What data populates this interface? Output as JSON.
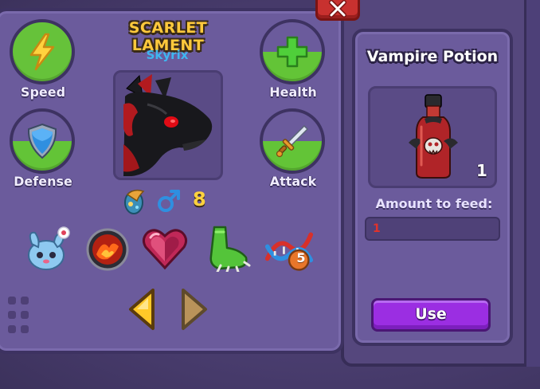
{
  "pet": {
    "name": "SCARLET LAMENT",
    "owner": "Skyrix",
    "level": "8",
    "gender": "male"
  },
  "stats": {
    "speed_label": "Speed",
    "health_label": "Health",
    "defense_label": "Defense",
    "attack_label": "Attack"
  },
  "traits": [
    "bunny-pet-icon",
    "fire-orb-icon",
    "heart-gem-icon",
    "green-claw-icon",
    "dna-level-5-icon"
  ],
  "dna_badge": "5",
  "item": {
    "title": "Vampire Potion",
    "count": "1",
    "feed_label": "Amount to feed:",
    "feed_value": "1",
    "use_label": "Use"
  },
  "colors": {
    "panel": "#6b5b9c",
    "accent_green": "#63c437",
    "title_gold": "#ffc93c",
    "owner_blue": "#3fb6f0",
    "use_purple": "#9b2ee2",
    "close_red": "#c8312f"
  }
}
